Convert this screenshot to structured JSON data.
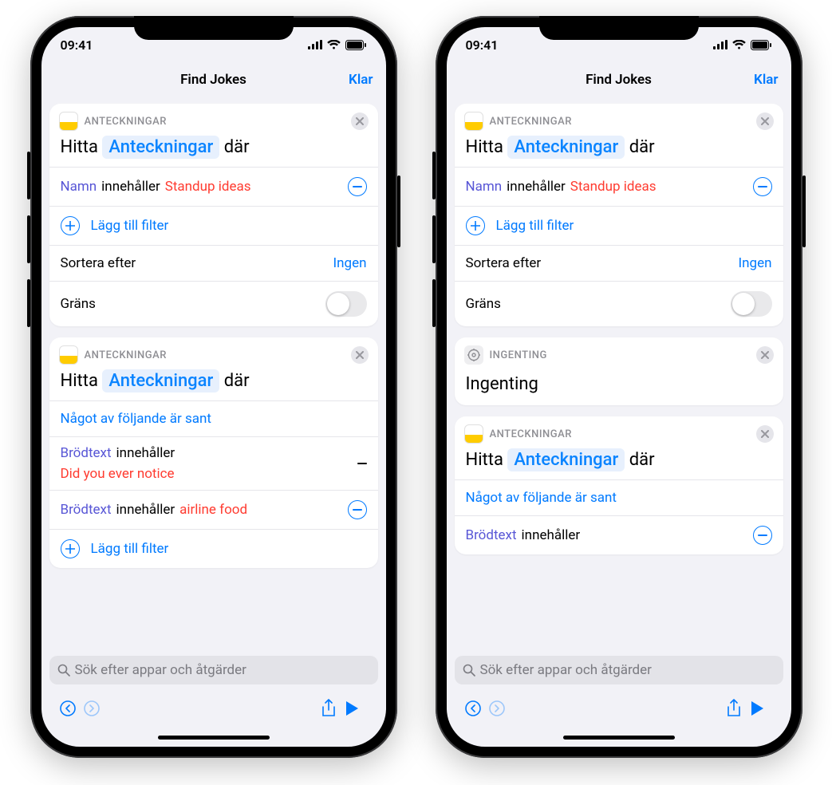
{
  "common": {
    "time": "09:41",
    "nav_title": "Find Jokes",
    "done": "Klar",
    "search_placeholder": "Sök efter appar och åtgärder"
  },
  "left": {
    "card1": {
      "app": "ANTECKNINGAR",
      "prefix": "Hitta",
      "entity": "Anteckningar",
      "suffix": "där",
      "filter": {
        "field": "Namn",
        "op": "innehåller",
        "value": "Standup ideas"
      },
      "add_filter": "Lägg till filter",
      "sort_label": "Sortera efter",
      "sort_value": "Ingen",
      "limit_label": "Gräns"
    },
    "card2": {
      "app": "ANTECKNINGAR",
      "prefix": "Hitta",
      "entity": "Anteckningar",
      "suffix": "där",
      "any": "Något av följande är sant",
      "f1": {
        "field": "Brödtext",
        "op": "innehåller",
        "value": "Did you ever notice"
      },
      "f2": {
        "field": "Brödtext",
        "op": "innehåller",
        "value": "airline food"
      },
      "add_filter": "Lägg till filter"
    }
  },
  "right": {
    "card1": {
      "app": "ANTECKNINGAR",
      "prefix": "Hitta",
      "entity": "Anteckningar",
      "suffix": "där",
      "filter": {
        "field": "Namn",
        "op": "innehåller",
        "value": "Standup ideas"
      },
      "add_filter": "Lägg till filter",
      "sort_label": "Sortera efter",
      "sort_value": "Ingen",
      "limit_label": "Gräns"
    },
    "card2": {
      "app": "INGENTING",
      "body": "Ingenting"
    },
    "card3": {
      "app": "ANTECKNINGAR",
      "prefix": "Hitta",
      "entity": "Anteckningar",
      "suffix": "där",
      "any": "Något av följande är sant",
      "f1": {
        "field": "Brödtext",
        "op": "innehåller"
      }
    }
  }
}
